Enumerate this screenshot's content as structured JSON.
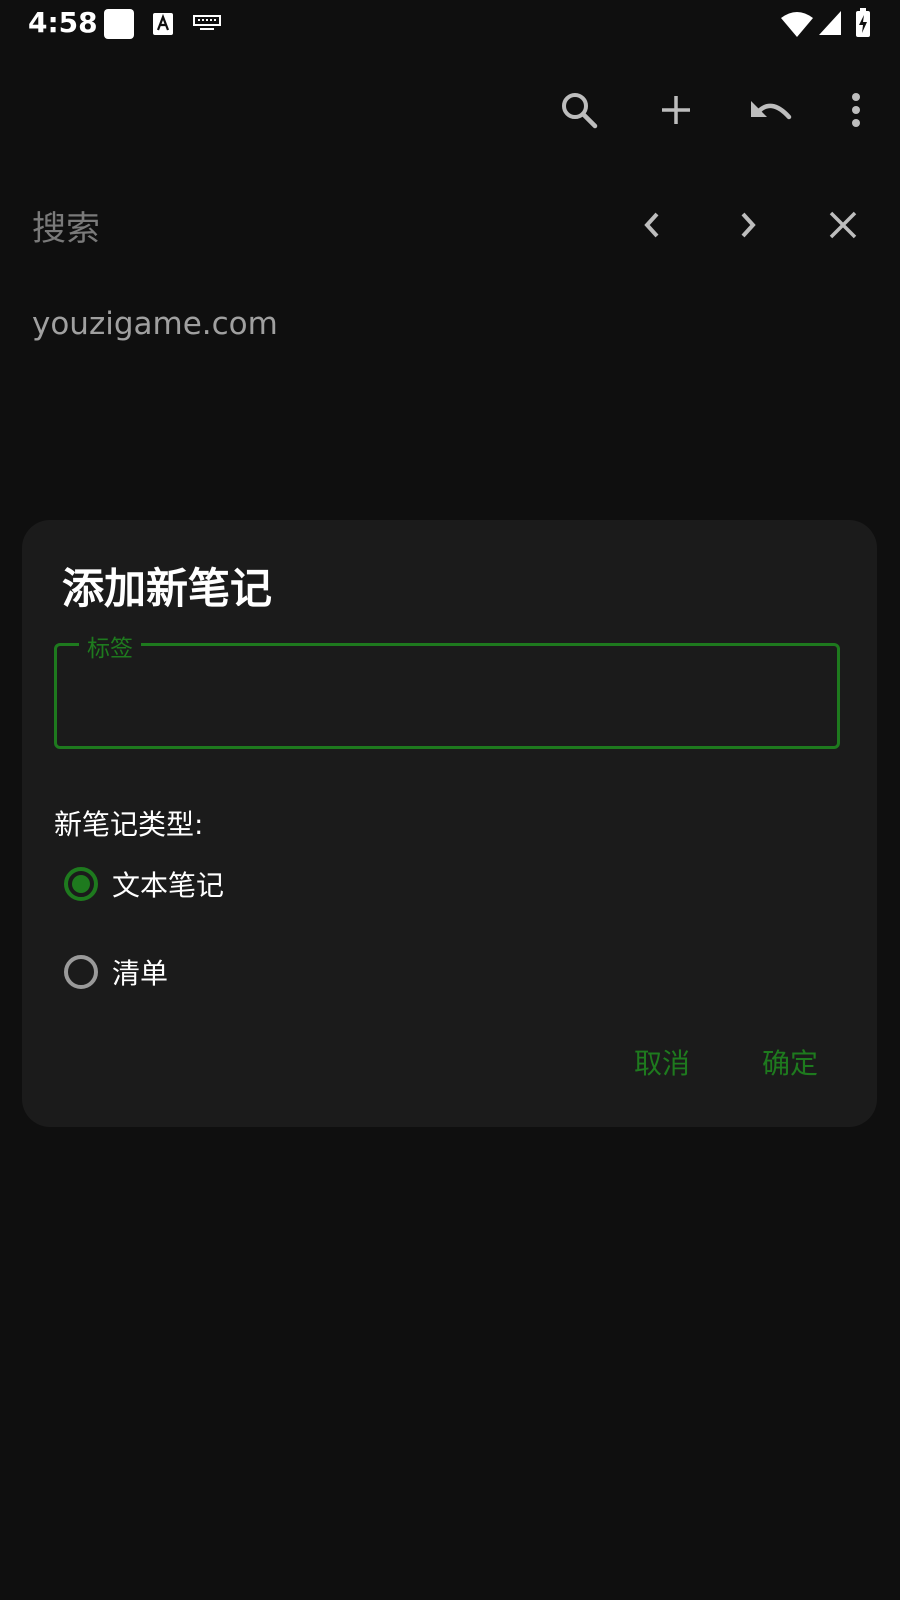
{
  "status_bar": {
    "time": "4:58",
    "icons": [
      "white-square-icon",
      "font-a-icon",
      "keyboard-icon",
      "wifi-icon",
      "signal-icon",
      "battery-charging-icon"
    ]
  },
  "toolbar": {
    "icons": [
      "search-icon",
      "plus-icon",
      "undo-icon",
      "more-vert-icon"
    ]
  },
  "search": {
    "placeholder": "搜索",
    "icons": [
      "chevron-left-icon",
      "chevron-right-icon",
      "close-icon"
    ]
  },
  "note": {
    "text": "youzigame.com"
  },
  "dialog": {
    "title": "添加新笔记",
    "field": {
      "label": "标签",
      "value": ""
    },
    "type_label": "新笔记类型:",
    "options": [
      {
        "label": "文本笔记",
        "checked": true
      },
      {
        "label": "清单",
        "checked": false
      }
    ],
    "cancel_label": "取消",
    "ok_label": "确定"
  },
  "colors": {
    "accent": "#1e7a1e",
    "background": "#0f0f0f",
    "dialog": "#1b1b1b"
  }
}
